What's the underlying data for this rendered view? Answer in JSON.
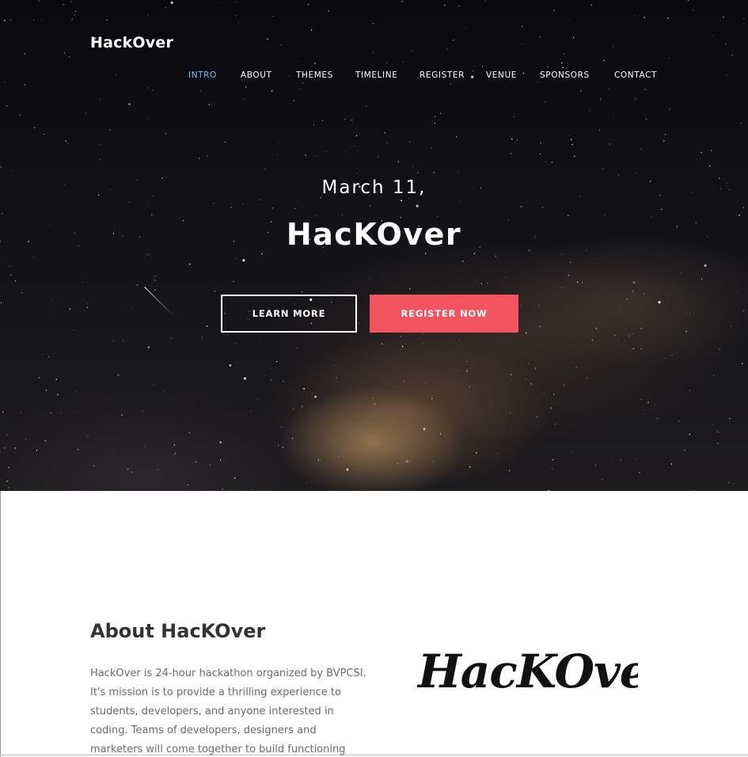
{
  "header": {
    "logo": "HackOver",
    "nav": [
      {
        "label": "INTRO",
        "active": true
      },
      {
        "label": "ABOUT",
        "active": false
      },
      {
        "label": "THEMES",
        "active": false
      },
      {
        "label": "TIMELINE",
        "active": false
      },
      {
        "label": "REGISTER",
        "active": false
      },
      {
        "label": "VENUE",
        "active": false
      },
      {
        "label": "SPONSORS",
        "active": false
      },
      {
        "label": "CONTACT",
        "active": false
      }
    ]
  },
  "hero": {
    "date": "March 11,",
    "title": "HacKOver",
    "learn_more_label": "LEARN MORE",
    "register_label": "REGISTER NOW"
  },
  "about": {
    "title": "About HacKOver",
    "text": "HackOver is 24-hour hackathon organized by BVPCSI. It's mission is to provide a thrilling experience to students, developers, and anyone interested in coding. Teams of developers, designers and marketers will come together to build functioning",
    "logo_text": "HacKOver"
  },
  "colors": {
    "accent": "#6ec3ee",
    "register_button": "#f2545f",
    "hero_background": "#0a0a0c"
  }
}
